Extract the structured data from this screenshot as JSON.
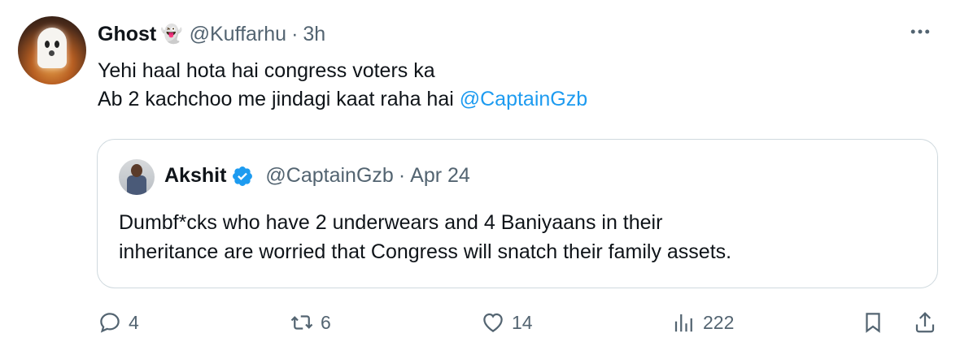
{
  "tweet": {
    "author_name": "Ghost",
    "author_emoji": "👻",
    "handle": "@Kuffarhu",
    "separator": "·",
    "time": "3h",
    "more_icon": "more-dots-icon",
    "text_line1": "Yehi haal hota hai congress voters ka",
    "text_line2": "Ab 2 kachchoo me jindagi kaat raha hai ",
    "mention": "@CaptainGzb"
  },
  "quote": {
    "author_name": "Akshit",
    "verified_icon": "verified-badge-icon",
    "handle": "@CaptainGzb",
    "separator": "·",
    "date": "Apr 24",
    "text_line1": "Dumbf*cks who have 2 underwears and 4 Baniyaans in their",
    "text_line2": "inheritance are worried that Congress will snatch their family assets."
  },
  "actions": {
    "replies": "4",
    "retweets": "6",
    "likes": "14",
    "views": "222"
  },
  "colors": {
    "accent": "#1d9bf0",
    "secondary_text": "#536471",
    "border": "#cfd9de"
  }
}
